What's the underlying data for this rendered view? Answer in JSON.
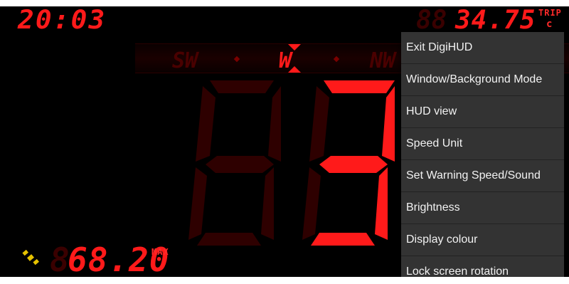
{
  "hud": {
    "clock": "20:03",
    "trip_distance": "34.75",
    "trip_ghost": "88",
    "trip_label": "TRIP",
    "trip_unit": "c",
    "compass": {
      "left": "SW",
      "center": "W",
      "right": "NW"
    },
    "speed": {
      "value": "3",
      "ghost_digits": "88"
    },
    "max_speed": "68.20",
    "max_ghost": "8",
    "max_label": "MAX"
  },
  "menu": {
    "items": [
      "Exit DigiHUD",
      "Window/Background Mode",
      "HUD view",
      "Speed Unit",
      "Set Warning Speed/Sound",
      "Brightness",
      "Display colour",
      "Lock screen rotation"
    ]
  },
  "colors": {
    "accent": "#ff1a1a",
    "ghost": "#3a0000",
    "menu_bg": "#333333",
    "menu_text": "#f2f2f2"
  }
}
